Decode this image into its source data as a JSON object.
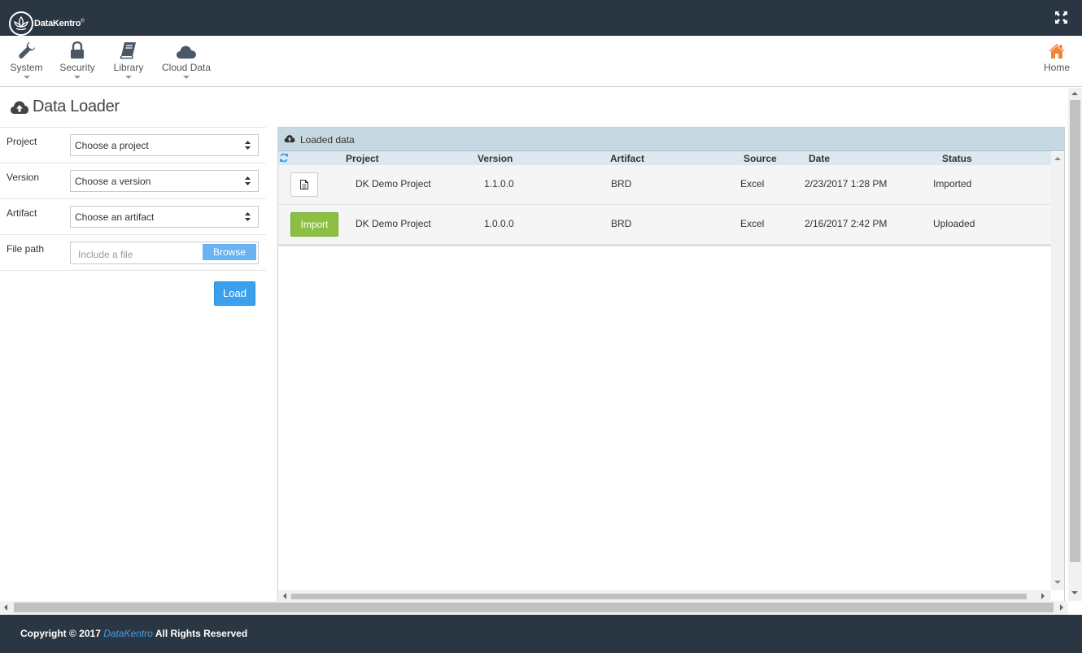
{
  "header": {
    "logo_text": "DataKentro",
    "logo_mark": "®"
  },
  "nav": {
    "items": [
      {
        "label": "System",
        "icon": "wrench-icon"
      },
      {
        "label": "Security",
        "icon": "lock-icon"
      },
      {
        "label": "Library",
        "icon": "book-icon"
      },
      {
        "label": "Cloud Data",
        "icon": "cloud-icon"
      }
    ],
    "home_label": "Home"
  },
  "page": {
    "title": "Data Loader"
  },
  "form": {
    "project_label": "Project",
    "project_value": "Choose a project",
    "version_label": "Version",
    "version_value": "Choose a version",
    "artifact_label": "Artifact",
    "artifact_value": "Choose an artifact",
    "filepath_label": "File path",
    "file_placeholder": "Include a file",
    "browse_label": "Browse",
    "load_label": "Load"
  },
  "panel": {
    "title": "Loaded data",
    "columns": [
      "Project",
      "Version",
      "Artifact",
      "Source",
      "Date",
      "Status"
    ],
    "rows": [
      {
        "action": "document",
        "project": "DK Demo Project",
        "version": "1.1.0.0",
        "artifact": "BRD",
        "source": "Excel",
        "date": "2/23/2017 1:28 PM",
        "status": "Imported"
      },
      {
        "action": "Import",
        "project": "DK Demo Project",
        "version": "1.0.0.0",
        "artifact": "BRD",
        "source": "Excel",
        "date": "2/16/2017 2:42 PM",
        "status": "Uploaded"
      }
    ]
  },
  "footer": {
    "prefix": "Copyright © 2017",
    "brand": "DataKentro",
    "suffix": "All Rights Reserved"
  },
  "colors": {
    "header_bg": "#2b3643",
    "accent_blue": "#3ba1ef",
    "import_green": "#8cc043",
    "home_orange": "#f0843c"
  }
}
